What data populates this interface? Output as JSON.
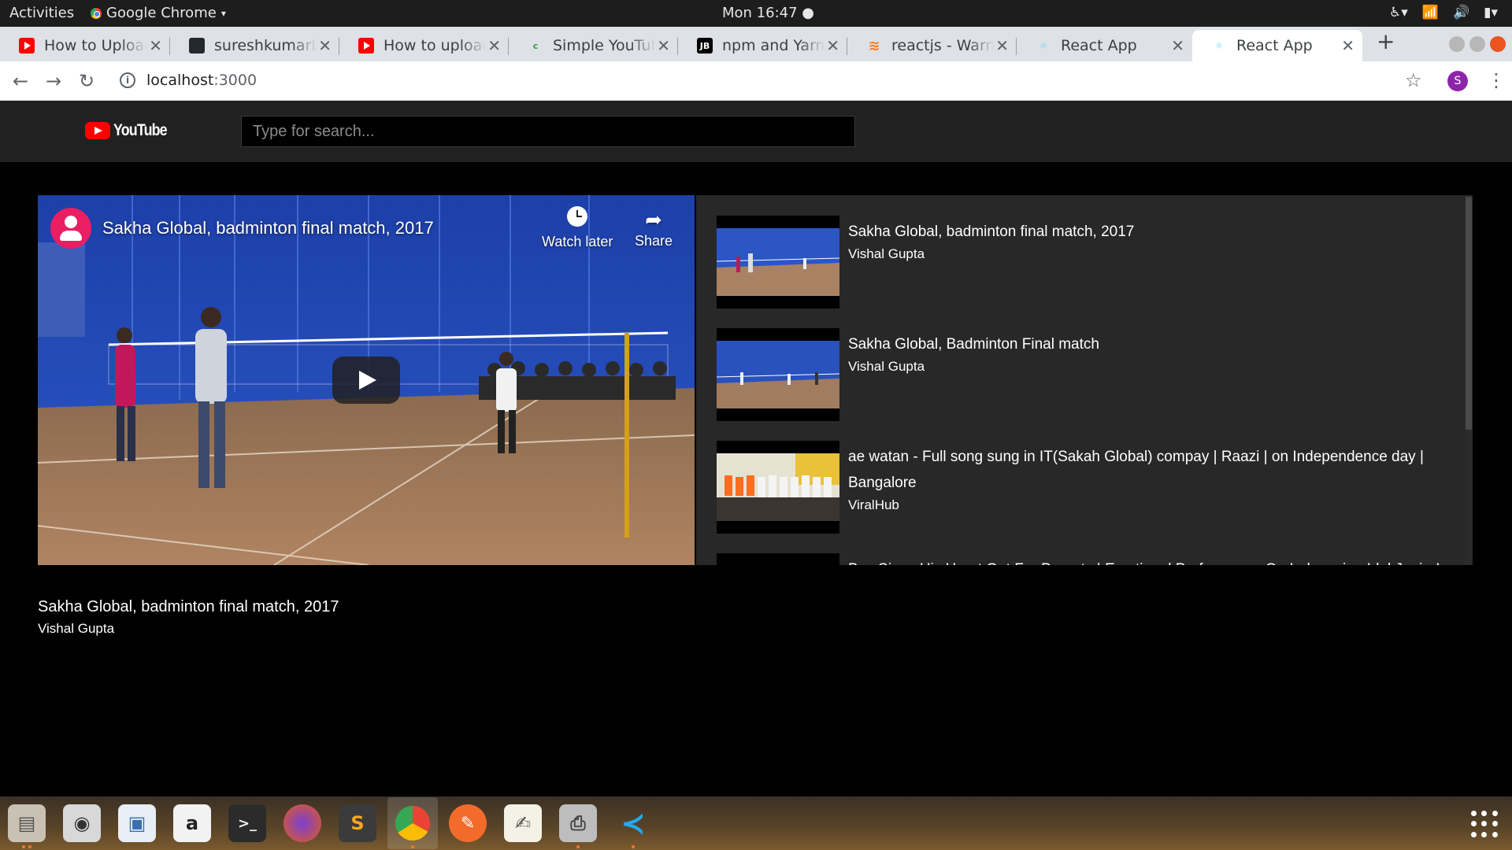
{
  "system": {
    "activities": "Activities",
    "app_name": "Google Chrome",
    "clock": "Mon 16:47 ●"
  },
  "tabs": [
    {
      "title": "How to Upload",
      "icon": "youtube-icon"
    },
    {
      "title": "sureshkumarbe",
      "icon": "github-icon"
    },
    {
      "title": "How to upload",
      "icon": "youtube-icon"
    },
    {
      "title": "Simple YouTub",
      "icon": "codesandbox-icon"
    },
    {
      "title": "npm and Yarn",
      "icon": "jetbrains-icon"
    },
    {
      "title": "reactjs - Warnin",
      "icon": "stackoverflow-icon"
    },
    {
      "title": "React App",
      "icon": "react-icon"
    },
    {
      "title": "React App",
      "icon": "react-icon",
      "active": true
    }
  ],
  "omnibox": {
    "host": "localhost",
    "port": ":3000",
    "profile_initial": "S"
  },
  "app": {
    "logo_text": "YouTube",
    "search_placeholder": "Type for search..."
  },
  "player": {
    "title": "Sakha Global, badminton final match, 2017",
    "watch_later": "Watch later",
    "share": "Share"
  },
  "videos": [
    {
      "title": "Sakha Global, badminton final match, 2017",
      "channel": "Vishal Gupta"
    },
    {
      "title": "Sakha Global, Badminton Final match",
      "channel": "Vishal Gupta"
    },
    {
      "title": "ae watan - Full song sung in IT(Sakah Global) compay | Raazi | on Independence day | Bangalore",
      "channel": "ViralHub"
    },
    {
      "title": "Boy Sings His Heart Out For Parents | Emotional Performance On Indonesian Idol Junior!",
      "channel": ""
    }
  ],
  "selected": {
    "title": "Sakha Global, badminton final match, 2017",
    "channel": "Vishal Gupta"
  },
  "colors": {
    "brand_red": "#ff0000",
    "header_bg": "#212121",
    "list_bg": "#282828"
  }
}
